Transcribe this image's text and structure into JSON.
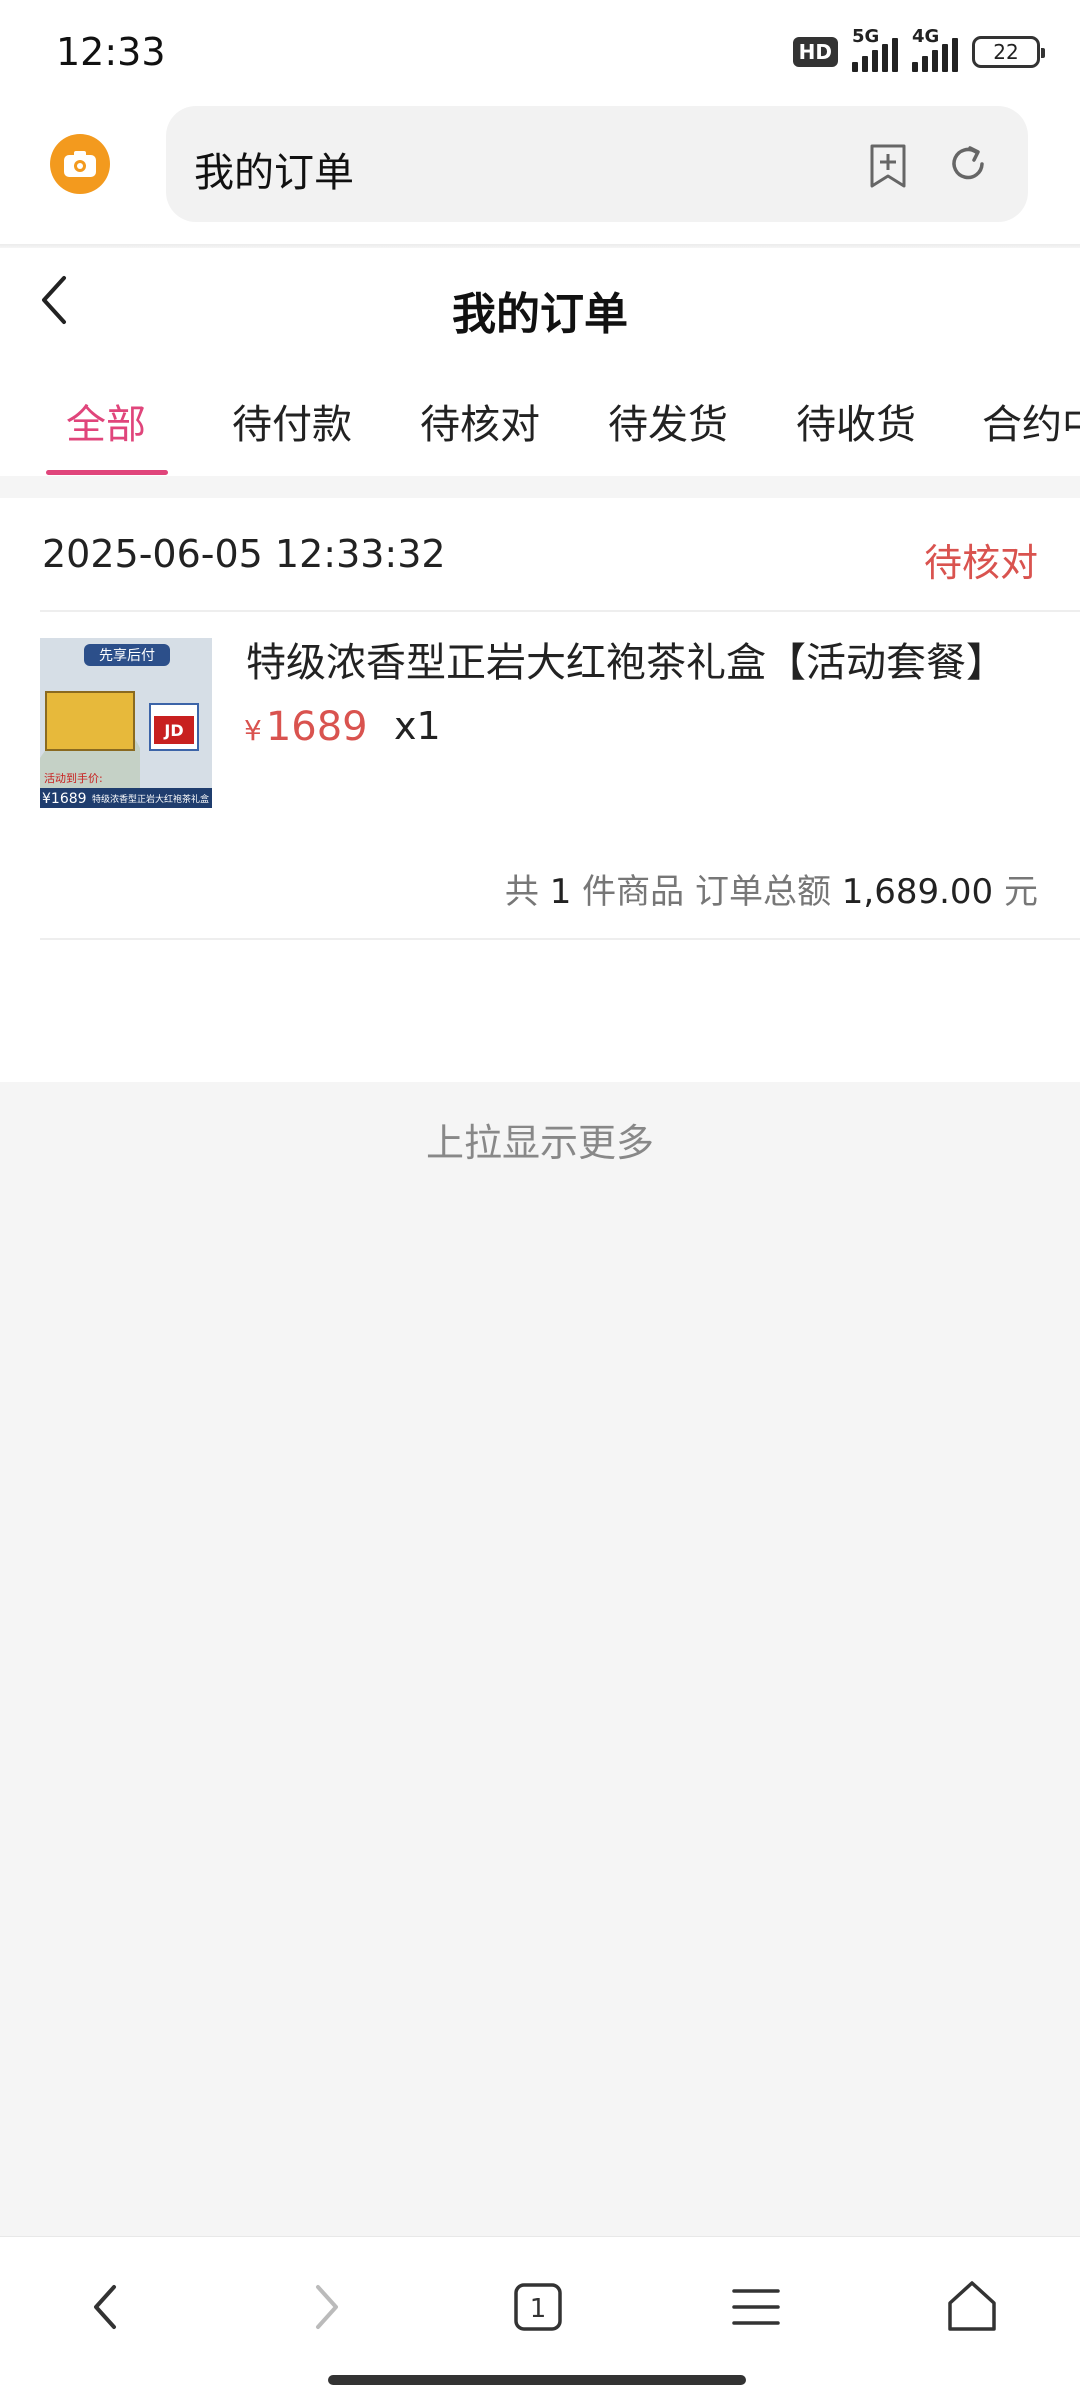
{
  "status_bar": {
    "time": "12:33",
    "hd_badge": "HD",
    "network1": "5G",
    "network2": "4G",
    "battery": "22"
  },
  "browser": {
    "url_text": "我的订单"
  },
  "header": {
    "title": "我的订单"
  },
  "tabs": [
    {
      "label": "全部",
      "active": true
    },
    {
      "label": "待付款"
    },
    {
      "label": "待核对"
    },
    {
      "label": "待发货"
    },
    {
      "label": "待收货"
    },
    {
      "label": "合约中"
    }
  ],
  "order": {
    "time": "2025-06-05 12:33:32",
    "status": "待核对",
    "product_name": "特级浓香型正岩大红袍茶礼盒【活动套餐】",
    "price_currency": "¥",
    "price": "1689",
    "quantity": "x1",
    "summary": {
      "prefix": "共",
      "count": "1",
      "count_suffix": "件商品 订单总额",
      "total": "1,689.00",
      "unit": "元"
    },
    "image_text": {
      "badge": "先享后付",
      "promo": "活动到手价:",
      "price": "¥1689",
      "caption": "特级浓香型正岩大红袍茶礼盒",
      "jd": "JD"
    }
  },
  "load_more": "上拉显示更多",
  "bottom_nav": {
    "tab_count": "1"
  },
  "colors": {
    "accent_pink": "#e0457b",
    "price_red": "#d9534f",
    "camera_orange": "#f39a1e"
  }
}
